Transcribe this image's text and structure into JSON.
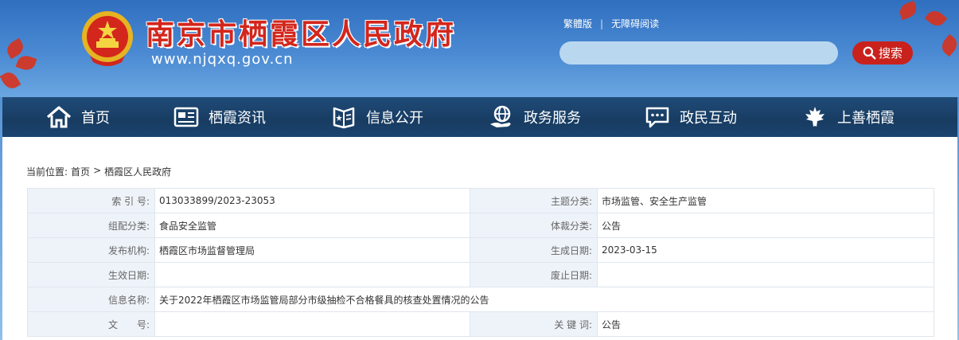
{
  "header": {
    "site_title": "南京市栖霞区人民政府",
    "site_url": "www.njqxq.gov.cn",
    "traditional_link": "繁體版",
    "separator": "|",
    "accessibility_link": "无障碍阅读",
    "search_placeholder": "",
    "search_button": "搜索"
  },
  "nav": {
    "items": [
      {
        "label": "首页",
        "icon": "home-icon"
      },
      {
        "label": "栖霞资讯",
        "icon": "newspaper-icon"
      },
      {
        "label": "信息公开",
        "icon": "book-star-icon"
      },
      {
        "label": "政务服务",
        "icon": "service-globe-icon"
      },
      {
        "label": "政民互动",
        "icon": "chat-icon"
      },
      {
        "label": "上善栖霞",
        "icon": "maple-leaf-icon"
      }
    ]
  },
  "breadcrumb": {
    "prefix": "当前位置:",
    "home": "首页",
    "separator": ">",
    "current": "栖霞区人民政府"
  },
  "meta": {
    "index_label": "索 引 号:",
    "index_value": "013033899/2023-23053",
    "subject_label": "主题分类:",
    "subject_value": "市场监管、安全生产监管",
    "org_category_label": "组配分类:",
    "org_category_value": "食品安全监管",
    "genre_label": "体裁分类:",
    "genre_value": "公告",
    "publisher_label": "发布机构:",
    "publisher_value": "栖霞区市场监督管理局",
    "created_label": "生成日期:",
    "created_value": "2023-03-15",
    "effective_label": "生效日期:",
    "effective_value": "",
    "expiry_label": "废止日期:",
    "expiry_value": "",
    "name_label": "信息名称:",
    "name_value": "关于2022年栖霞区市场监管局部分市级抽检不合格餐具的核查处置情况的公告",
    "doc_no_label": "文　　号:",
    "doc_no_value": "",
    "keywords_label": "关 键 词:",
    "keywords_value": "公告"
  },
  "colors": {
    "header_blue": "#3f7fc7",
    "nav_navy": "#1b4470",
    "title_red": "#d3261c",
    "search_red": "#c9221c"
  }
}
